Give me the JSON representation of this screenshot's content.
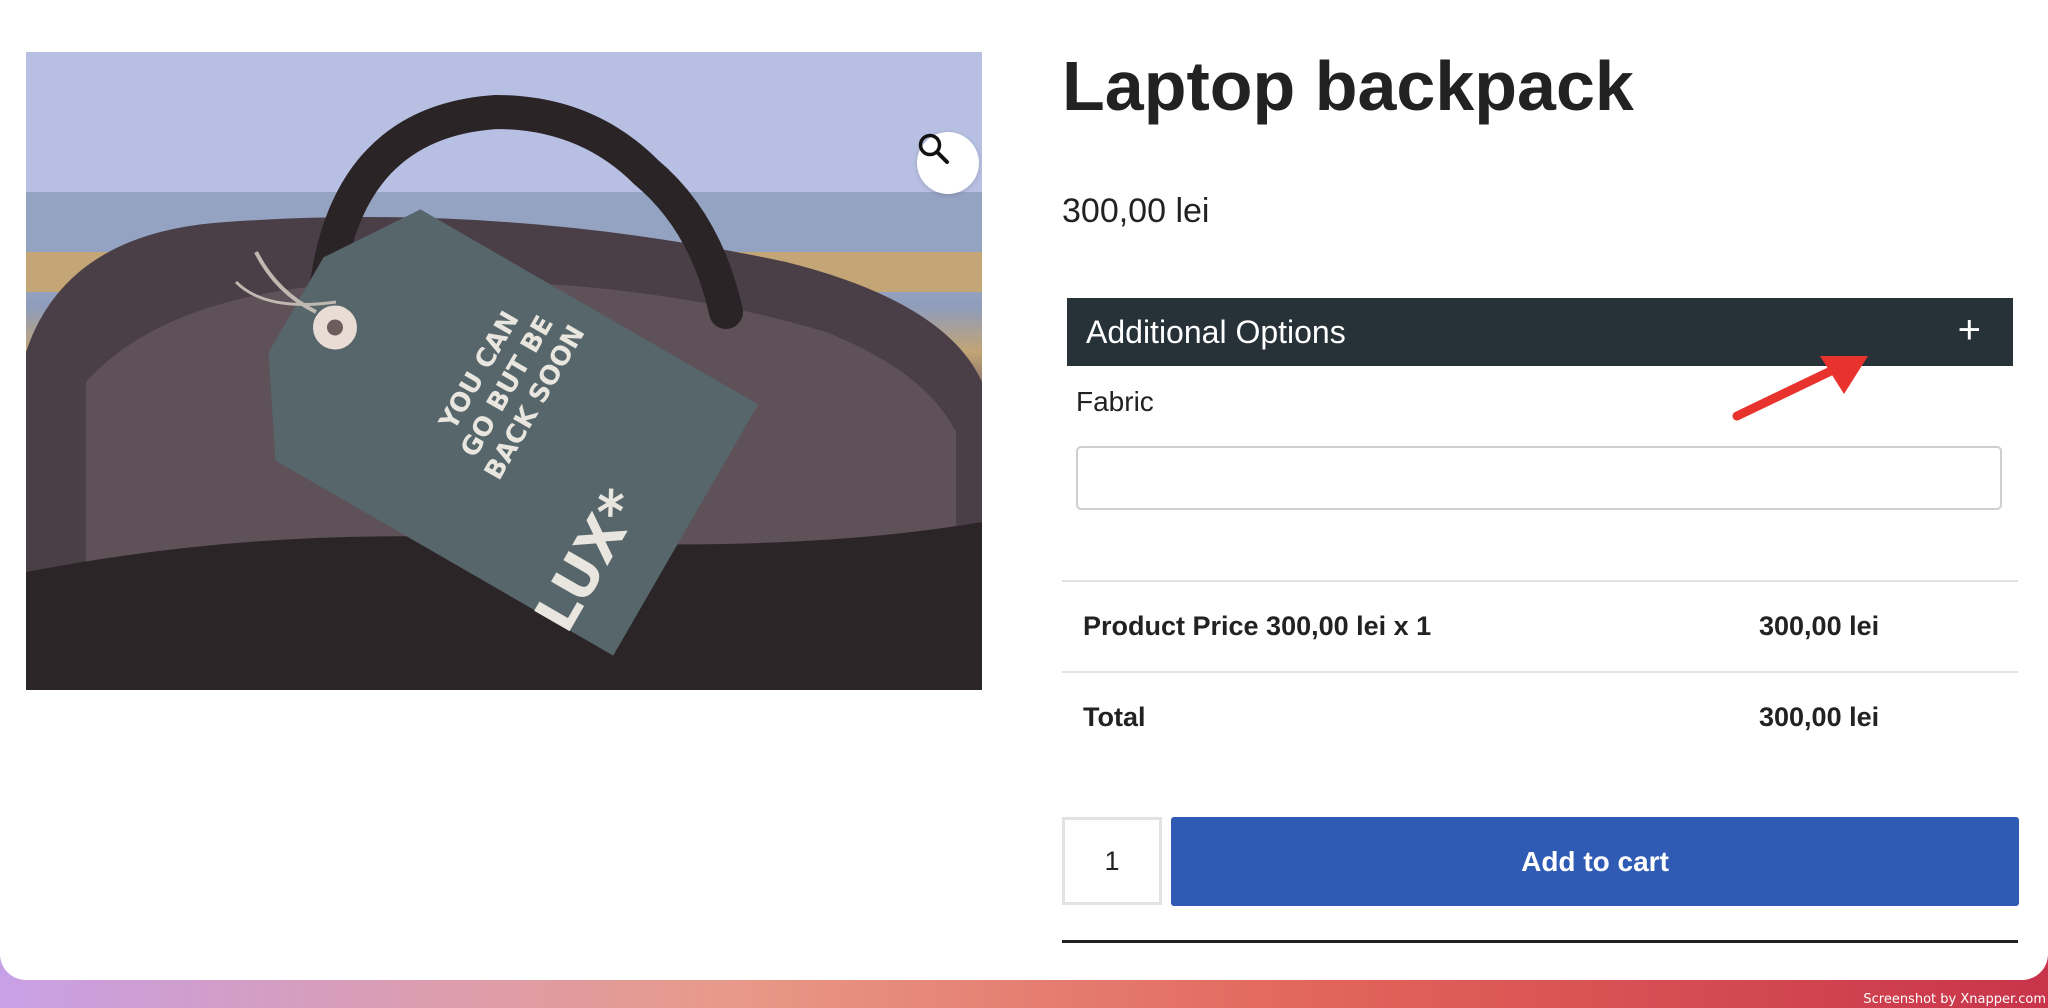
{
  "product": {
    "title": "Laptop backpack",
    "price": "300,00 lei",
    "image_alt": "Laptop backpack"
  },
  "image_tag": {
    "line1": "YOU CAN",
    "line2": "GO BUT BE",
    "line3": "BACK SOON",
    "brand": "LUX*"
  },
  "zoom": {
    "icon": "magnifier-icon"
  },
  "options": {
    "header": "Additional Options",
    "toggle": "+",
    "fabric_label": "Fabric",
    "fabric_value": ""
  },
  "summary": {
    "rows": [
      {
        "label": "Product Price 300,00 lei x 1",
        "value": "300,00 lei"
      },
      {
        "label": "Total",
        "value": "300,00 lei"
      }
    ]
  },
  "cart": {
    "quantity": "1",
    "button_label": "Add to cart"
  },
  "colors": {
    "options_header_bg": "#263238",
    "cart_button_bg": "#2f5bb4",
    "annotation_arrow": "#e8322d"
  },
  "watermark": "Screenshot by Xnapper.com"
}
